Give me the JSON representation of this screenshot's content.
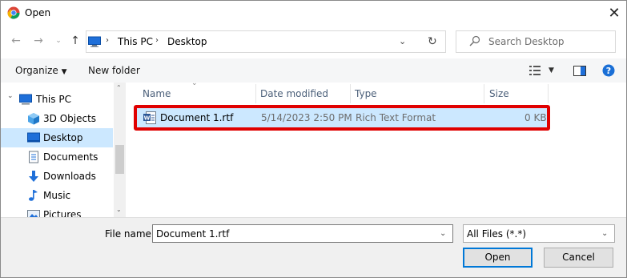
{
  "window": {
    "title": "Open"
  },
  "nav": {
    "breadcrumb": [
      "This PC",
      "Desktop"
    ],
    "search_placeholder": "Search Desktop"
  },
  "toolbar": {
    "organize_label": "Organize",
    "new_folder_label": "New folder"
  },
  "sidebar": {
    "items": [
      {
        "label": "This PC",
        "icon": "computer-icon",
        "selected": false
      },
      {
        "label": "3D Objects",
        "icon": "cube-icon",
        "selected": false
      },
      {
        "label": "Desktop",
        "icon": "desktop-icon",
        "selected": true
      },
      {
        "label": "Documents",
        "icon": "documents-icon",
        "selected": false
      },
      {
        "label": "Downloads",
        "icon": "download-icon",
        "selected": false
      },
      {
        "label": "Music",
        "icon": "music-icon",
        "selected": false
      },
      {
        "label": "Pictures",
        "icon": "pictures-icon",
        "selected": false
      }
    ]
  },
  "list": {
    "columns": [
      "Name",
      "Date modified",
      "Type",
      "Size"
    ],
    "rows": [
      {
        "name": "Document 1.rtf",
        "date": "5/14/2023 2:50 PM",
        "type": "Rich Text Format",
        "size": "0 KB",
        "selected": true,
        "highlighted": true
      }
    ]
  },
  "bottom": {
    "file_name_label": "File name:",
    "file_name_value": "Document 1.rtf",
    "file_type_value": "All Files (*.*)",
    "open_label": "Open",
    "cancel_label": "Cancel"
  },
  "colors": {
    "selection": "#cce8ff",
    "highlight_border": "#e00000",
    "accent": "#0078d7",
    "help": "#1a6fd6"
  }
}
